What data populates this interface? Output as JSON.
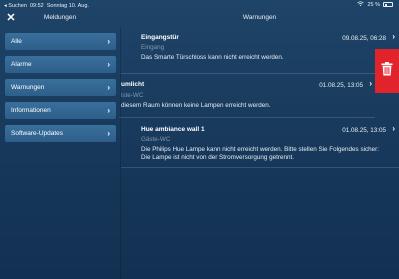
{
  "status_bar": {
    "back_label": "◂ Suchen",
    "time": "09:52",
    "date": "Sonntag 10. Aug.",
    "battery": "25 %"
  },
  "header": {
    "left_title": "Meldungen",
    "right_title": "Warnungen"
  },
  "sidebar": {
    "items": [
      {
        "label": "Alle"
      },
      {
        "label": "Alarme"
      },
      {
        "label": "Warnungen"
      },
      {
        "label": "Informationen"
      },
      {
        "label": "Software-Updates"
      }
    ]
  },
  "warnings": [
    {
      "title": "Eingangstür",
      "time": "09.08.25, 06:28",
      "location": "Eingang",
      "message": "Das Smarte Türschloss kann nicht erreicht werden."
    },
    {
      "title": "umlicht",
      "time": "01.08.25, 13:05",
      "location": "iste-WC",
      "message": "diesem Raum können keine Lampen erreicht werden."
    },
    {
      "title": "Hue ambiance wall 1",
      "time": "01.08.25, 13:05",
      "location": "Gäste-WC",
      "message": "Die Philips Hue Lampe kann nicht erreicht werden. Bitte stellen Sie Folgendes sicher:",
      "message2": "Die Lampe ist nicht von der Stromversorgung getrennt."
    }
  ],
  "colors": {
    "accent_button": "#2e5f8a",
    "delete": "#e1242c",
    "subtitle": "#7f9ab3"
  }
}
